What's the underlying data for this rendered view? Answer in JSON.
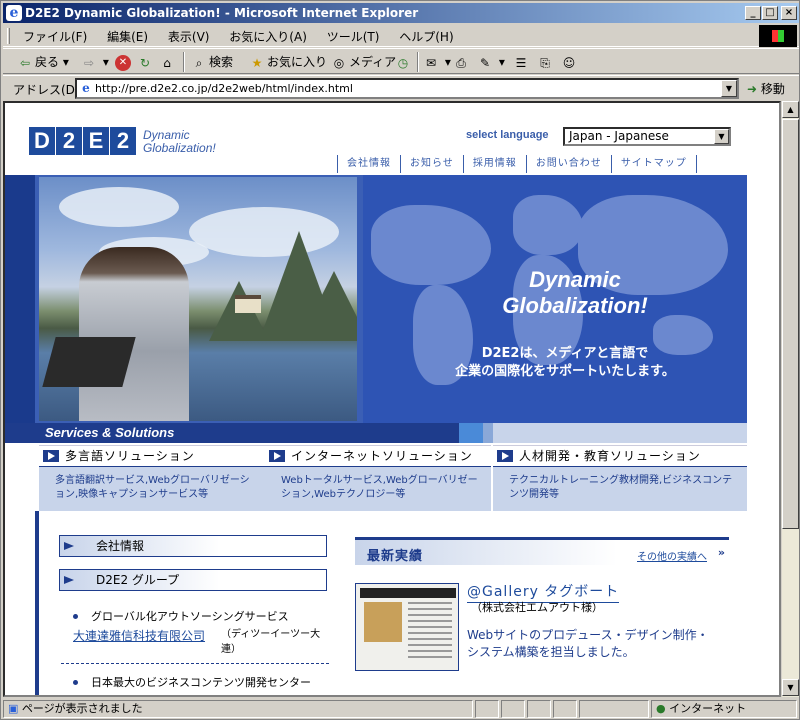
{
  "window": {
    "title": "D2E2 Dynamic Globalization! - Microsoft Internet Explorer",
    "min": "_",
    "max": "□",
    "close": "×"
  },
  "menubar": [
    "ファイル(F)",
    "編集(E)",
    "表示(V)",
    "お気に入り(A)",
    "ツール(T)",
    "ヘルプ(H)"
  ],
  "toolbar": {
    "back": "戻る",
    "search": "検索",
    "favorites": "お気に入り",
    "media": "メディア"
  },
  "address": {
    "label": "アドレス(D)",
    "url": "http://pre.d2e2.co.jp/d2e2web/html/index.html",
    "go": "移動"
  },
  "status": {
    "text": "ページが表示されました",
    "zone": "インターネット"
  },
  "page": {
    "logo": {
      "letters": [
        "D",
        "2",
        "E",
        "2"
      ],
      "tag_line1": "Dynamic",
      "tag_line2": "Globalization!"
    },
    "select_language_label": "select language",
    "language_value": "Japan - Japanese",
    "nav": [
      "会社情報",
      "お知らせ",
      "採用情報",
      "お問い合わせ",
      "サイトマップ"
    ],
    "hero": {
      "headline_line1": "Dynamic",
      "headline_line2": "Globalization!",
      "sub_line1": "D2E2は、メディアと言語で",
      "sub_line2": "企業の国際化をサポートいたします。"
    },
    "services_label": "Services & Solutions",
    "services": [
      {
        "title": "多言語ソリューション",
        "desc": "多言語翻訳サービス,Webグローバリゼーション,映像キャプションサービス等"
      },
      {
        "title": "インターネットソリューション",
        "desc": "Webトータルサービス,Webグローバリゼーション,Webテクノロジー等"
      },
      {
        "title": "人材開発・教育ソリューション",
        "desc": "テクニカルトレーニング教材開発,ビジネスコンテンツ開発等"
      }
    ],
    "side_buttons": [
      "会社情報",
      "D2E2 グループ"
    ],
    "group_items": [
      {
        "caption": "グローバル化アウトソーシングサービス",
        "link": "大連達雅信科技有限公司",
        "note": "（ディツーイーツー大連）"
      },
      {
        "caption": "日本最大のビジネスコンテンツ開発センター"
      }
    ],
    "recent": {
      "title": "最新実績",
      "more": "その他の実績へ",
      "more_arrow": "»",
      "item_title": "@Gallery タグボート",
      "item_client": "（株式会社エムアウト様）",
      "item_desc": "Webサイトのプロデュース・デザイン制作・システム構築を担当しました。"
    }
  }
}
